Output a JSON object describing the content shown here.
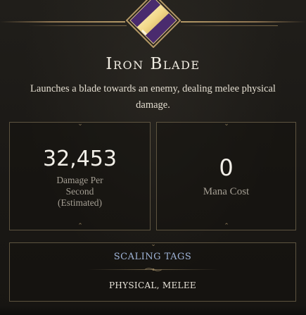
{
  "skill": {
    "name": "Iron Blade",
    "icon": "sword-blade-icon",
    "description": "Launches a blade towards an enemy, dealing melee physical damage."
  },
  "stats": {
    "damage_per_second": {
      "value": "32,453",
      "label_line1": "Damage Per",
      "label_line2": "Second",
      "label_line3": "(Estimated)"
    },
    "mana_cost": {
      "value": "0",
      "label": "Mana Cost"
    }
  },
  "scaling": {
    "title": "SCALING TAGS",
    "tags": "PHYSICAL, MELEE"
  },
  "colors": {
    "accent_gold": "#b39866",
    "tag_title_blue": "#9fb4d8",
    "icon_purple": "#4a2b6e"
  }
}
